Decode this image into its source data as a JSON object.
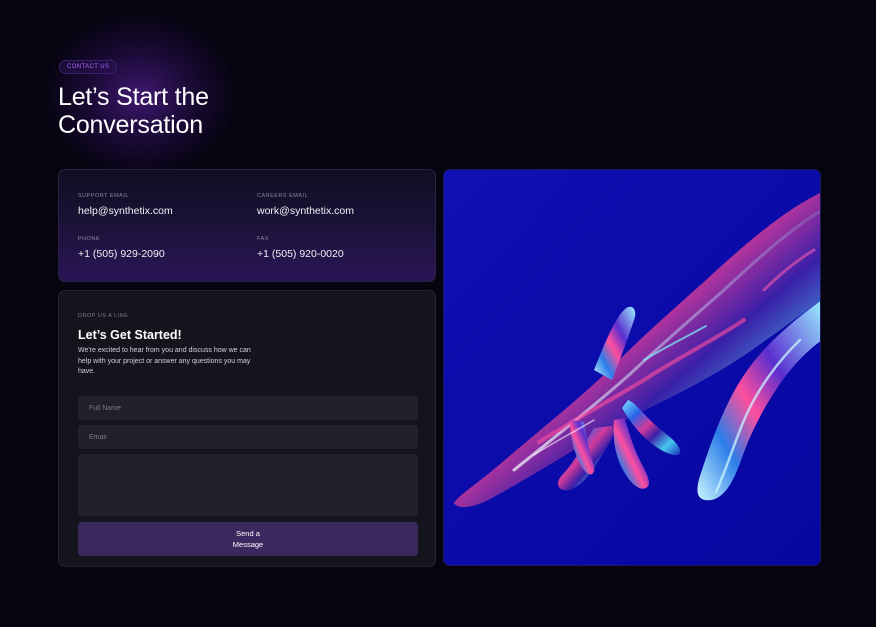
{
  "header": {
    "badge": "CONTACT US",
    "title": "Let’s Start the Conversation"
  },
  "contact_info": {
    "support_email": {
      "label": "SUPPORT EMAIL",
      "value": "help@synthetix.com"
    },
    "careers_email": {
      "label": "CAREERS EMAIL",
      "value": "work@synthetix.com"
    },
    "phone": {
      "label": "PHONE",
      "value": "+1 (505) 929-2090"
    },
    "fax": {
      "label": "FAX",
      "value": "+1 (505) 920-0020"
    }
  },
  "form": {
    "eyebrow": "DROP US A LINE",
    "title": "Let’s Get Started!",
    "description": "We're excited to hear from you and discuss how we can help with your project or answer any questions you may have.",
    "full_name_placeholder": "Full Name",
    "email_placeholder": "Email",
    "message_placeholder": "",
    "submit_label": "Send a Message"
  },
  "image": {
    "icon": "iridescent-chrome-hand-illustration"
  },
  "colors": {
    "background": "#05040f",
    "accent": "#a866ff",
    "button": "#3b285f",
    "image_background": "#0a0aa6"
  }
}
